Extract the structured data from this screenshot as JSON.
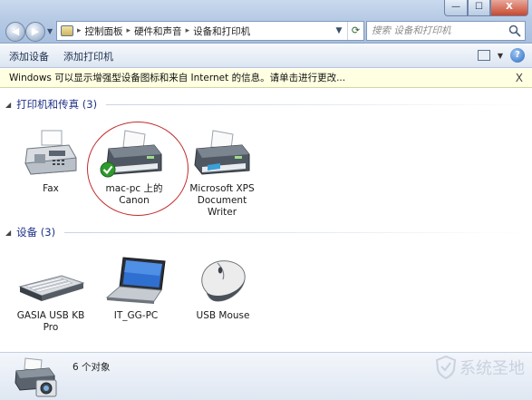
{
  "window": {
    "minimize_label": "—",
    "maximize_label": "☐",
    "close_label": "X"
  },
  "address": {
    "crumbs": [
      "控制面板",
      "硬件和声音",
      "设备和打印机"
    ],
    "separator": "▸"
  },
  "search": {
    "placeholder": "搜索 设备和打印机"
  },
  "toolbar": {
    "add_device": "添加设备",
    "add_printer": "添加打印机",
    "help": "?"
  },
  "infobar": {
    "message": "Windows 可以显示增强型设备图标和来自 Internet 的信息。请单击进行更改...",
    "close": "X"
  },
  "groups": {
    "printers": {
      "title": "打印机和传真 (3)",
      "items": [
        {
          "label": "Fax",
          "icon": "fax-icon"
        },
        {
          "label": "mac-pc 上的 Canon",
          "icon": "printer-icon",
          "default": true
        },
        {
          "label": "Microsoft XPS Document Writer",
          "icon": "printer-icon"
        }
      ]
    },
    "devices": {
      "title": "设备 (3)",
      "items": [
        {
          "label": "GASIA USB KB Pro",
          "icon": "keyboard-icon"
        },
        {
          "label": "IT_GG-PC",
          "icon": "laptop-icon"
        },
        {
          "label": "USB Mouse",
          "icon": "mouse-icon"
        }
      ]
    }
  },
  "details": {
    "count": "6 个对象"
  },
  "watermark": {
    "text": "系统圣地"
  },
  "colors": {
    "group_header": "#1e3287",
    "infobar_bg": "#ffffe1",
    "highlight_ring": "#c22b2b",
    "default_check": "#2f9a2f"
  }
}
